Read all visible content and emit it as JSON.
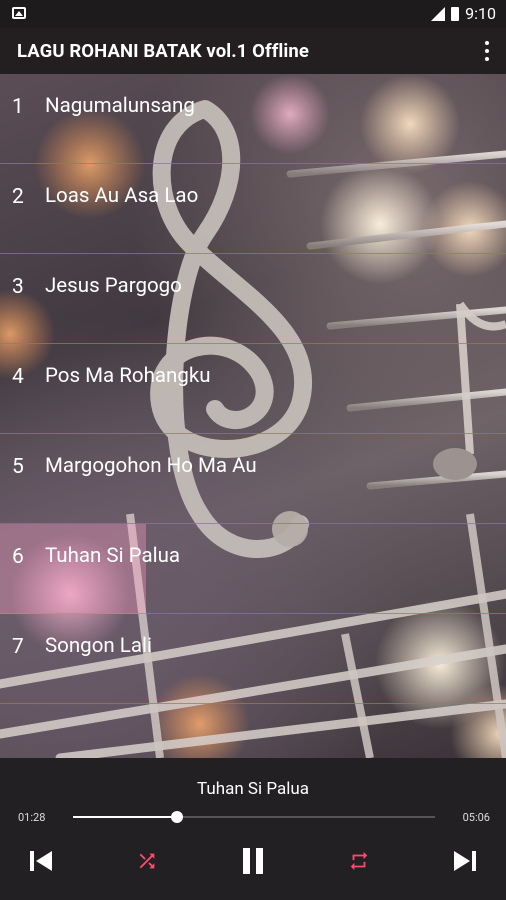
{
  "status_bar": {
    "time": "9:10"
  },
  "app_bar": {
    "title": "LAGU ROHANI BATAK vol.1 Offline"
  },
  "songs": [
    {
      "num": "1",
      "title": "Nagumalunsang"
    },
    {
      "num": "2",
      "title": "Loas Au Asa Lao"
    },
    {
      "num": "3",
      "title": "Jesus Pargogo"
    },
    {
      "num": "4",
      "title": "Pos Ma Rohangku"
    },
    {
      "num": "5",
      "title": "Margogohon Ho Ma Au"
    },
    {
      "num": "6",
      "title": "Tuhan Si Palua",
      "active": true
    },
    {
      "num": "7",
      "title": "Songon Lali"
    }
  ],
  "player": {
    "now_playing": "Tuhan Si Palua",
    "elapsed": "01:28",
    "duration": "05:06",
    "progress": 0.287
  },
  "colors": {
    "accent": "#ff4a6e",
    "divider": "#ff465a"
  }
}
